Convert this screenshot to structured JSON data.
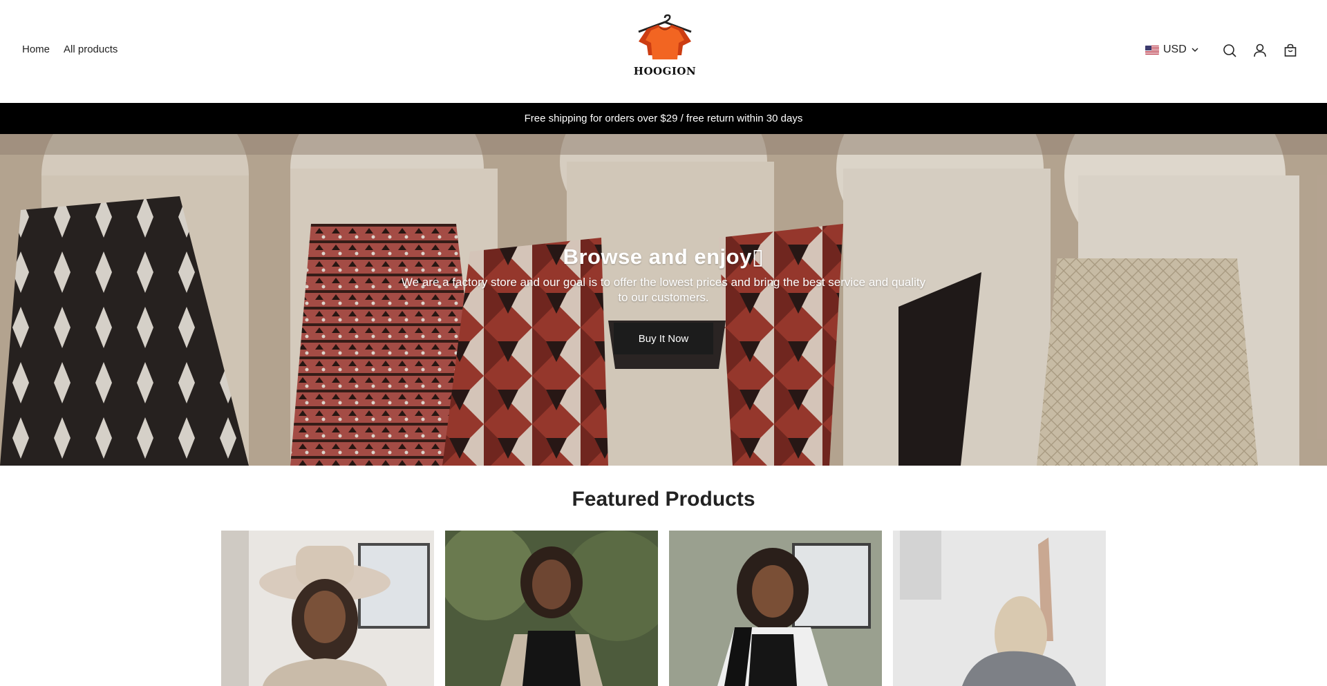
{
  "nav": {
    "items": [
      "Home",
      "All products"
    ]
  },
  "brand": {
    "name": "HOOGION"
  },
  "currency": {
    "code": "USD",
    "flag": "us-flag-icon"
  },
  "icons": {
    "search": "search-icon",
    "account": "user-icon",
    "cart": "shopping-bag-icon"
  },
  "announcement": {
    "text": "Free shipping for orders over $29 / free return within 30 days"
  },
  "hero": {
    "title": "Browse and enjoy▯",
    "subtitle": "We are a factory store and our goal is to offer the lowest prices and bring the best service and quality to our customers.",
    "button_label": "Buy It Now"
  },
  "featured": {
    "title": "Featured Products",
    "products": [
      "product-image-1",
      "product-image-2",
      "product-image-3",
      "product-image-4"
    ]
  },
  "colors": {
    "accent": "#e8541f",
    "bar": "#000000",
    "button": "#1c1c1c"
  }
}
